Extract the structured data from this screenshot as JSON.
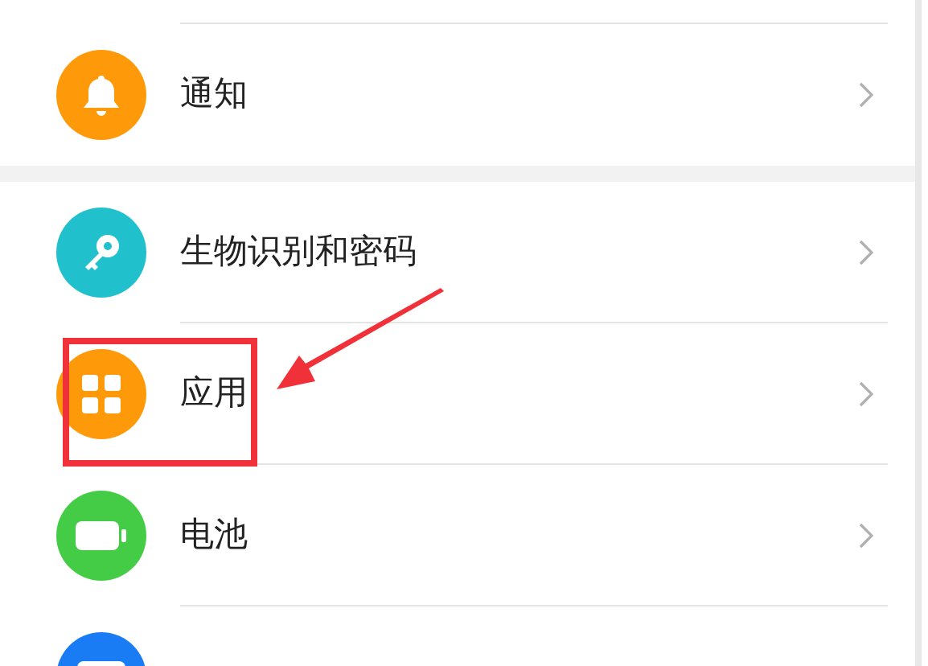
{
  "groups": [
    {
      "items": [
        {
          "label": "通知",
          "kind": "bell",
          "color": "#fe9a0a",
          "highlighted": false
        }
      ]
    },
    {
      "items": [
        {
          "label": "生物识别和密码",
          "kind": "key",
          "color": "#20c0cc",
          "highlighted": false
        },
        {
          "label": "应用",
          "kind": "apps",
          "color": "#fe9a0a",
          "highlighted": true
        },
        {
          "label": "电池",
          "kind": "battery",
          "color": "#45cc47",
          "highlighted": false
        },
        {
          "kind": "card",
          "color": "#1a7cf5",
          "highlighted": false
        }
      ]
    }
  ]
}
